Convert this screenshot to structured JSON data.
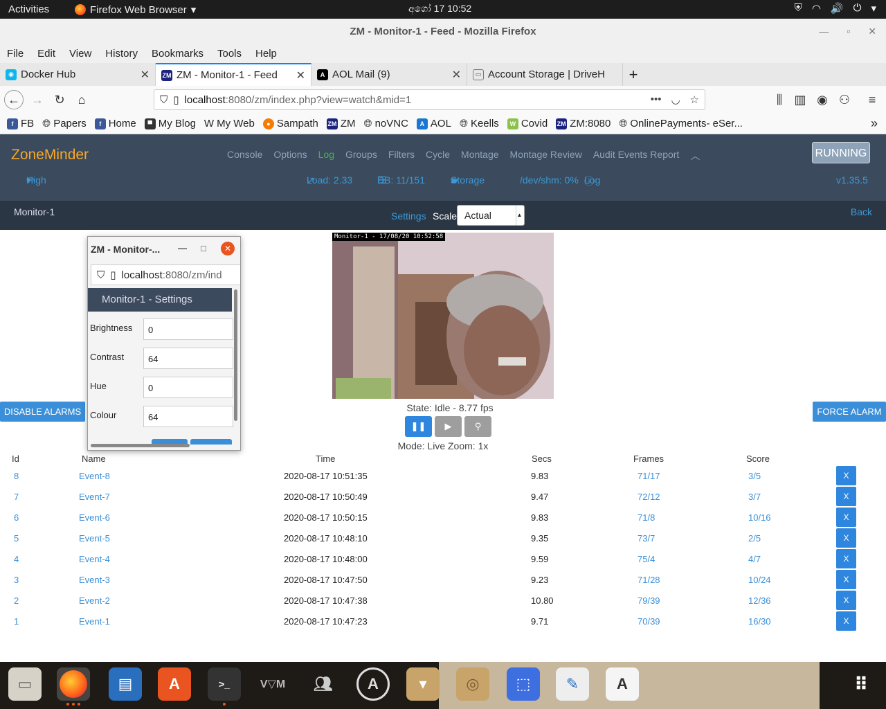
{
  "topbar": {
    "activities": "Activities",
    "app_name": "Firefox Web Browser",
    "clock": "අගෝ 17  10:52"
  },
  "window": {
    "title": "ZM - Monitor-1 - Feed - Mozilla Firefox"
  },
  "menu": [
    "File",
    "Edit",
    "View",
    "History",
    "Bookmarks",
    "Tools",
    "Help"
  ],
  "tabs": [
    {
      "label": "Docker Hub",
      "active": false
    },
    {
      "label": "ZM - Monitor-1 - Feed",
      "active": true
    },
    {
      "label": "AOL Mail (9)",
      "active": false
    },
    {
      "label": "Account Storage | DriveH",
      "active": false
    }
  ],
  "url": {
    "host": "localhost",
    "rest": ":8080/zm/index.php?view=watch&mid=1"
  },
  "bookmarks": [
    "FB",
    "Papers",
    "Home",
    "My Blog",
    "My Web",
    "Sampath",
    "ZM",
    "noVNC",
    "AOL",
    "Keells",
    "Covid",
    "ZM:8080",
    "OnlinePayments- eSer..."
  ],
  "zm": {
    "brand": "ZoneMinder",
    "nav": [
      "Console",
      "Options",
      "Log",
      "Groups",
      "Filters",
      "Cycle",
      "Montage",
      "Montage Review",
      "Audit Events Report"
    ],
    "running": "RUNNING",
    "bandwidth": "High",
    "load": "Load: 2.33",
    "db": "DB: 11/151",
    "storage": "Storage",
    "shm": "/dev/shm: 0%",
    "log": "Log",
    "version": "v1.35.5"
  },
  "monitor": {
    "name": "Monitor-1",
    "settings": "Settings",
    "scale_label": "Scale:",
    "scale_value": "Actual",
    "back": "Back",
    "stamp": "Monitor-1 - 17/08/20 10:52:58",
    "state": "State: Idle - 8.77 fps",
    "mode": "Mode: Live   Zoom: 1x",
    "disable_alarms": "DISABLE ALARMS",
    "force_alarm": "FORCE ALARM"
  },
  "events": {
    "headers": {
      "id": "Id",
      "name": "Name",
      "time": "Time",
      "secs": "Secs",
      "frames": "Frames",
      "score": "Score"
    },
    "delete_label": "X",
    "rows": [
      {
        "id": "8",
        "name": "Event-8",
        "time": "2020-08-17 10:51:35",
        "secs": "9.83",
        "frames": "71/17",
        "score": "3/5"
      },
      {
        "id": "7",
        "name": "Event-7",
        "time": "2020-08-17 10:50:49",
        "secs": "9.47",
        "frames": "72/12",
        "score": "3/7"
      },
      {
        "id": "6",
        "name": "Event-6",
        "time": "2020-08-17 10:50:15",
        "secs": "9.83",
        "frames": "71/8",
        "score": "10/16"
      },
      {
        "id": "5",
        "name": "Event-5",
        "time": "2020-08-17 10:48:10",
        "secs": "9.35",
        "frames": "73/7",
        "score": "2/5"
      },
      {
        "id": "4",
        "name": "Event-4",
        "time": "2020-08-17 10:48:00",
        "secs": "9.59",
        "frames": "75/4",
        "score": "4/7"
      },
      {
        "id": "3",
        "name": "Event-3",
        "time": "2020-08-17 10:47:50",
        "secs": "9.23",
        "frames": "71/28",
        "score": "10/24"
      },
      {
        "id": "2",
        "name": "Event-2",
        "time": "2020-08-17 10:47:38",
        "secs": "10.80",
        "frames": "79/39",
        "score": "12/36"
      },
      {
        "id": "1",
        "name": "Event-1",
        "time": "2020-08-17 10:47:23",
        "secs": "9.71",
        "frames": "70/39",
        "score": "16/30"
      }
    ]
  },
  "popup": {
    "title": "ZM - Monitor-...",
    "url_host": "localhost",
    "url_rest": ":8080/zm/ind",
    "heading": "Monitor-1 - Settings",
    "fields": [
      {
        "label": "Brightness",
        "value": "0"
      },
      {
        "label": "Contrast",
        "value": "64"
      },
      {
        "label": "Hue",
        "value": "0"
      },
      {
        "label": "Colour",
        "value": "64"
      }
    ]
  },
  "colors": {
    "accent": "#3a8fd8",
    "zm_header": "#3b4a5c",
    "brand": "#f9a825"
  }
}
